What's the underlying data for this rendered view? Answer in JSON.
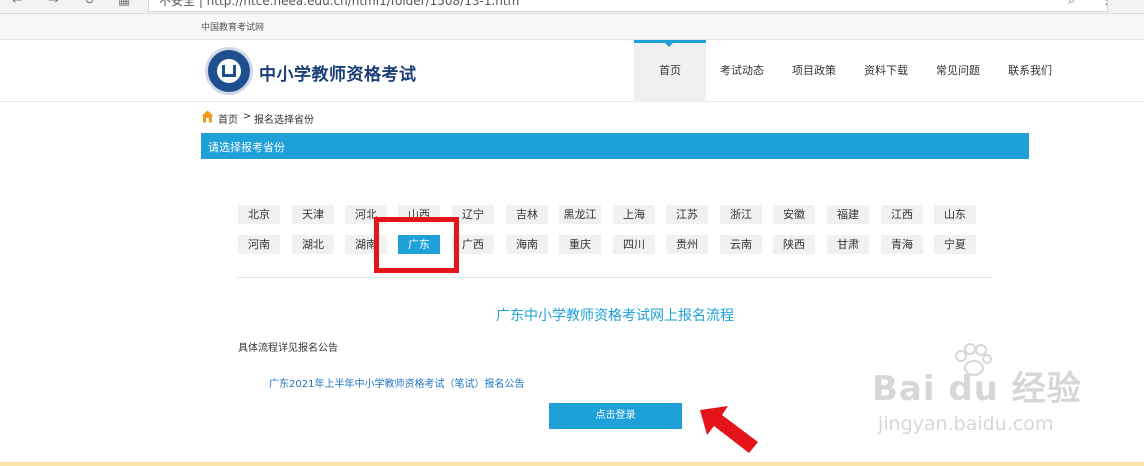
{
  "browser": {
    "address_text": "不安全 | http://ntce.neea.edu.cn/html1/folder/1508/13-1.htm",
    "icons": [
      "back-icon",
      "forward-icon",
      "reload-icon",
      "apps-icon",
      "search-icon",
      "more-icon"
    ]
  },
  "site": {
    "top_label": "中国教育考试网",
    "title": "中小学教师资格考试",
    "nav": [
      "首页",
      "考试动态",
      "项目政策",
      "资料下载",
      "常见问题",
      "联系我们"
    ],
    "active_nav": "首页"
  },
  "breadcrumb": {
    "home": "首页",
    "separator": ">",
    "current": "报名选择省份"
  },
  "section": {
    "title": "请选择报考省份"
  },
  "provinces": {
    "row1": [
      "北京",
      "天津",
      "河北",
      "山西",
      "辽宁",
      "吉林",
      "黑龙江",
      "上海",
      "江苏",
      "浙江",
      "安徽",
      "福建",
      "江西",
      "山东"
    ],
    "row2": [
      "河南",
      "湖北",
      "湖南",
      "广东",
      "广西",
      "海南",
      "重庆",
      "四川",
      "贵州",
      "云南",
      "陕西",
      "甘肃",
      "青海",
      "宁夏"
    ],
    "selected": "广东"
  },
  "process": {
    "title": "广东中小学教师资格考试网上报名流程",
    "detail": "具体流程详见报名公告",
    "notice_link": "广东2021年上半年中小学教师资格考试（笔试）报名公告",
    "login_button": "点击登录"
  },
  "watermark": {
    "logo": "Bai du 经验",
    "url": "jingyan.baidu.com"
  },
  "colors": {
    "accent": "#1ea0d8",
    "highlight": "#e5141b",
    "brand": "#1c3f78"
  }
}
